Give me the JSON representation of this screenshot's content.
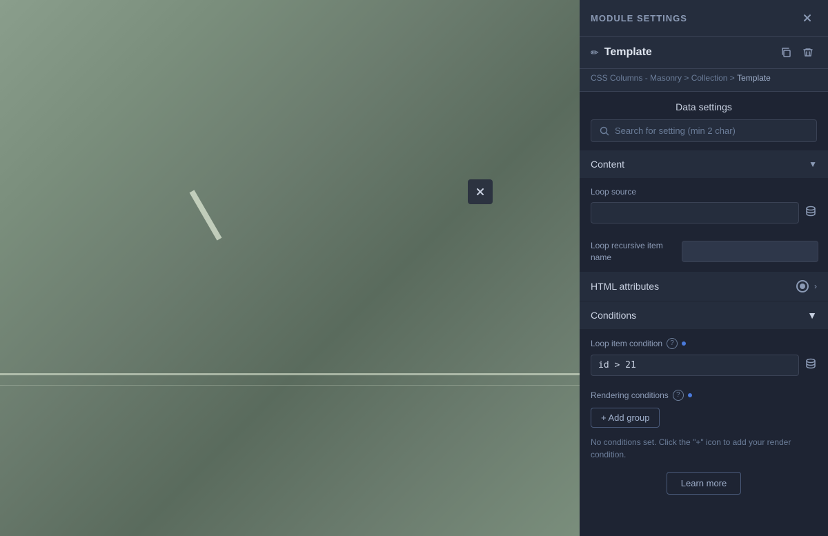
{
  "panel": {
    "header": {
      "title": "MODULE SETTINGS"
    },
    "template": {
      "icon": "✏",
      "title": "Template",
      "copy_tooltip": "Copy",
      "delete_tooltip": "Delete"
    },
    "breadcrumb": {
      "path": "CSS Columns - Masonry > Collection > Template",
      "parts": [
        "CSS Columns - Masonry",
        "Collection",
        "Template"
      ]
    },
    "data_settings_title": "Data settings",
    "search": {
      "placeholder": "Search for setting (min 2 char)"
    },
    "content_section": {
      "label": "Content"
    },
    "loop_source": {
      "label": "Loop source"
    },
    "loop_recursive": {
      "label": "Loop recursive item name"
    },
    "html_attributes": {
      "label": "HTML attributes"
    },
    "conditions": {
      "label": "Conditions"
    },
    "loop_item_condition": {
      "label": "Loop item condition",
      "value": "id > 21"
    },
    "rendering_conditions": {
      "label": "Rendering conditions",
      "add_group": "+ Add group",
      "no_conditions_text": "No conditions set. Click the \"+\" icon to add your render condition.",
      "learn_more": "Learn more"
    }
  },
  "canvas": {
    "close_label": "×"
  }
}
